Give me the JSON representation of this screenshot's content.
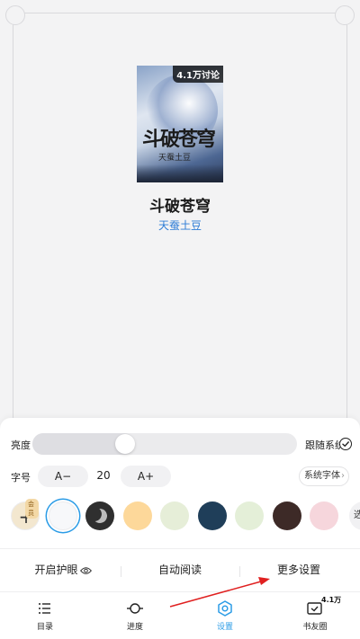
{
  "book": {
    "cover_title": "斗破苍穹",
    "cover_author": "天蚕土豆",
    "discussion_badge": "4.1万讨论",
    "title": "斗破苍穹",
    "author": "天蚕土豆"
  },
  "settings": {
    "brightness_label": "亮度",
    "brightness_level": 0.34,
    "follow_system_label": "跟随系统",
    "follow_system_checked": true,
    "font_size_label": "字号",
    "decrease_label": "A−",
    "font_size_value": "20",
    "increase_label": "A+",
    "font_face_label": "系统字体",
    "themes": [
      {
        "name": "add",
        "color": "#f3e7cf",
        "tag": "会员"
      },
      {
        "name": "white",
        "color": "#f7f8fa",
        "selected": true
      },
      {
        "name": "night",
        "color": "#2f2f2f"
      },
      {
        "name": "yellow",
        "color": "#fdd89a"
      },
      {
        "name": "pale-green",
        "color": "#e6eed8"
      },
      {
        "name": "navy",
        "color": "#1f3e59"
      },
      {
        "name": "green",
        "color": "#e4efd8"
      },
      {
        "name": "brown",
        "color": "#3d2a27"
      },
      {
        "name": "pink",
        "color": "#f6d6dc"
      }
    ],
    "more_theme_label": "选",
    "eye_care_label": "开启护眼",
    "auto_read_label": "自动阅读",
    "more_settings_label": "更多设置"
  },
  "nav": {
    "catalog": "目录",
    "progress": "进度",
    "settings": "设置",
    "circle": "书友圈",
    "circle_badge": "4.1万"
  },
  "colors": {
    "accent": "#2b9ce6",
    "annotation_arrow": "#e02020",
    "author_link": "#2e7cd6"
  }
}
